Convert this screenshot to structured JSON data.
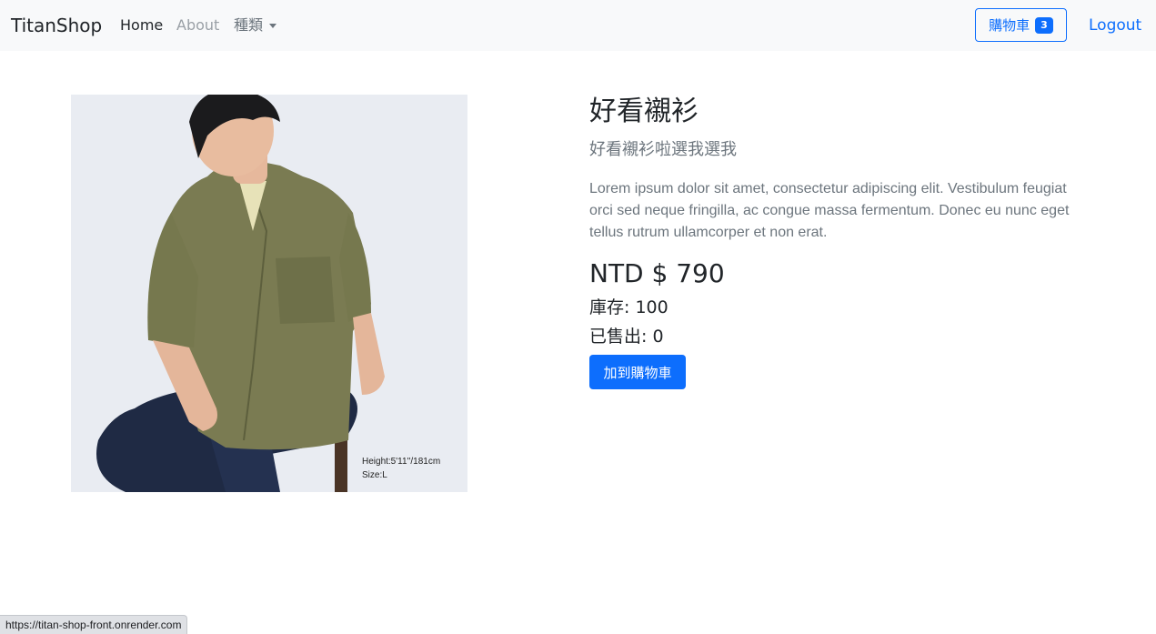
{
  "navbar": {
    "brand": "TitanShop",
    "links": {
      "home": "Home",
      "about": "About",
      "category": "種類"
    },
    "cart": {
      "label": "購物車",
      "count": "3"
    },
    "logout": "Logout"
  },
  "product": {
    "image_caption_height": "Height:5'11''/181cm",
    "image_caption_size": "Size:L",
    "title": "好看襯衫",
    "subtitle": "好看襯衫啦選我選我",
    "description": "Lorem ipsum dolor sit amet, consectetur adipiscing elit. Vestibulum feugiat orci sed neque fringilla, ac congue massa fermentum. Donec eu nunc eget tellus rutrum ullamcorper et non erat.",
    "price": "NTD $ 790",
    "stock": "庫存: 100",
    "sold": "已售出: 0",
    "add_to_cart": "加到購物車"
  },
  "status_bar": {
    "url": "https://titan-shop-front.onrender.com"
  },
  "colors": {
    "primary": "#0d6efd",
    "navbar_bg": "#f8f9fa",
    "muted_text": "#6c757d"
  }
}
